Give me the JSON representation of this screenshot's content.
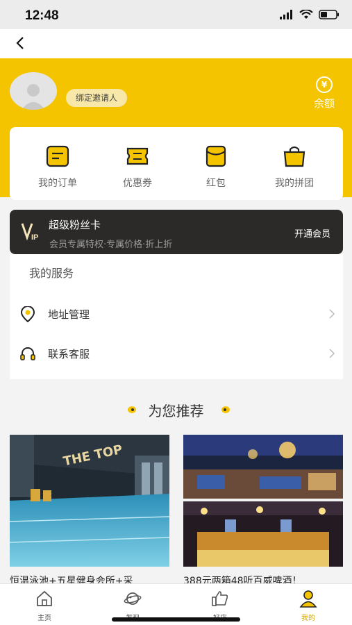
{
  "status_bar": {
    "time": "12:48"
  },
  "header": {
    "invite_label": "绑定邀请人",
    "balance_symbol": "¥",
    "balance_label": "余额"
  },
  "orders": [
    {
      "label": "我的订单",
      "icon": "order-list-icon"
    },
    {
      "label": "优惠券",
      "icon": "coupon-icon"
    },
    {
      "label": "红包",
      "icon": "red-envelope-icon"
    },
    {
      "label": "我的拼团",
      "icon": "group-buy-icon"
    }
  ],
  "vip": {
    "title": "超级粉丝卡",
    "subtitle": "会员专属特权·专属价格·折上折",
    "action": "开通会员"
  },
  "services": {
    "title": "我的服务",
    "items": [
      {
        "label": "地址管理",
        "icon": "location-icon"
      },
      {
        "label": "联系客服",
        "icon": "headset-icon"
      }
    ]
  },
  "recommend": {
    "title": "为您推荐",
    "items": [
      {
        "name": "恒温泳池+五星健身会所+采",
        "image_text": "THE TOP"
      },
      {
        "name": "388元两箱48听百威啤酒！"
      }
    ]
  },
  "tabs": [
    {
      "label": "主页",
      "icon": "home-icon",
      "active": false
    },
    {
      "label": "发现",
      "icon": "planet-icon",
      "active": false
    },
    {
      "label": "好店",
      "icon": "thumbs-up-icon",
      "active": false
    },
    {
      "label": "我的",
      "icon": "user-icon",
      "active": true
    }
  ],
  "colors": {
    "accent": "#f5c400",
    "vip_bg": "#2b2a29",
    "active_tab": "#d6a800"
  }
}
